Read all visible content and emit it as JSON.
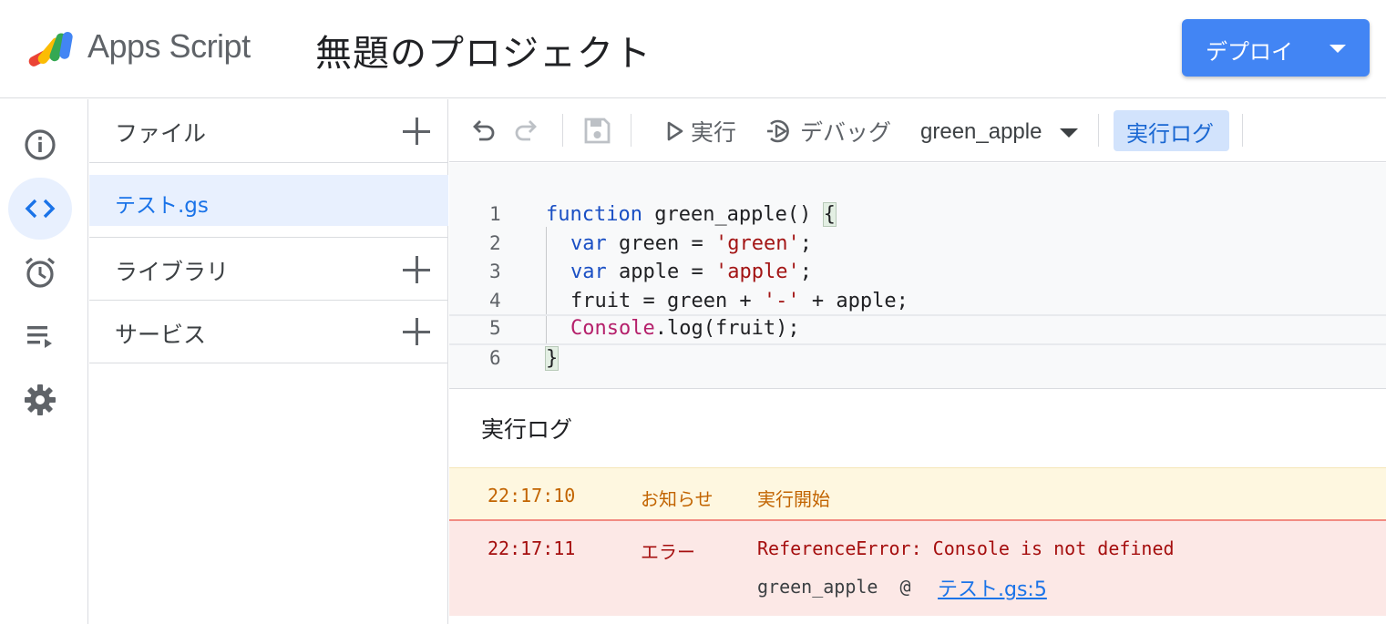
{
  "header": {
    "app_name": "Apps Script",
    "project_title": "無題のプロジェクト",
    "deploy_label": "デプロイ"
  },
  "rail": {
    "items": [
      {
        "icon": "info-icon",
        "label": "概要"
      },
      {
        "icon": "code-icon",
        "label": "エディタ",
        "active": true
      },
      {
        "icon": "alarm-icon",
        "label": "トリガー"
      },
      {
        "icon": "executions-icon",
        "label": "実行数"
      },
      {
        "icon": "gear-icon",
        "label": "プロジェクトの設定"
      }
    ]
  },
  "files": {
    "files_label": "ファイル",
    "active_file": "テスト.gs",
    "libraries_label": "ライブラリ",
    "services_label": "サービス"
  },
  "toolbar": {
    "run_label": "実行",
    "debug_label": "デバッグ",
    "function_selected": "green_apple",
    "log_toggle_label": "実行ログ"
  },
  "editor": {
    "line_numbers": [
      "1",
      "2",
      "3",
      "4",
      "5",
      "6"
    ],
    "code": {
      "l1_kw": "function",
      "l1_rest": " green_apple() ",
      "l1_brace": "{",
      "l2_kw": "var",
      "l2_mid": " green = ",
      "l2_str": "'green'",
      "l2_end": ";",
      "l3_kw": "var",
      "l3_mid": " apple = ",
      "l3_str": "'apple'",
      "l3_end": ";",
      "l4_a": "fruit = green + ",
      "l4_str": "'-'",
      "l4_b": " + apple;",
      "l5_cls": "Console",
      "l5_rest": ".log(fruit);",
      "l6_brace": "}"
    }
  },
  "log": {
    "title": "実行ログ",
    "entries": [
      {
        "time": "22:17:10",
        "level": "お知らせ",
        "message": "実行開始"
      },
      {
        "time": "22:17:11",
        "level": "エラー",
        "message": "ReferenceError: Console is not defined",
        "trace_prefix": "green_apple  @",
        "trace_link": "テスト.gs:5"
      }
    ]
  },
  "colors": {
    "accent": "#4285f4",
    "active_bg": "#e8f0fe",
    "info_bg": "#fef7e0",
    "error_bg": "#fce8e6",
    "error_text": "#a50e0e"
  }
}
